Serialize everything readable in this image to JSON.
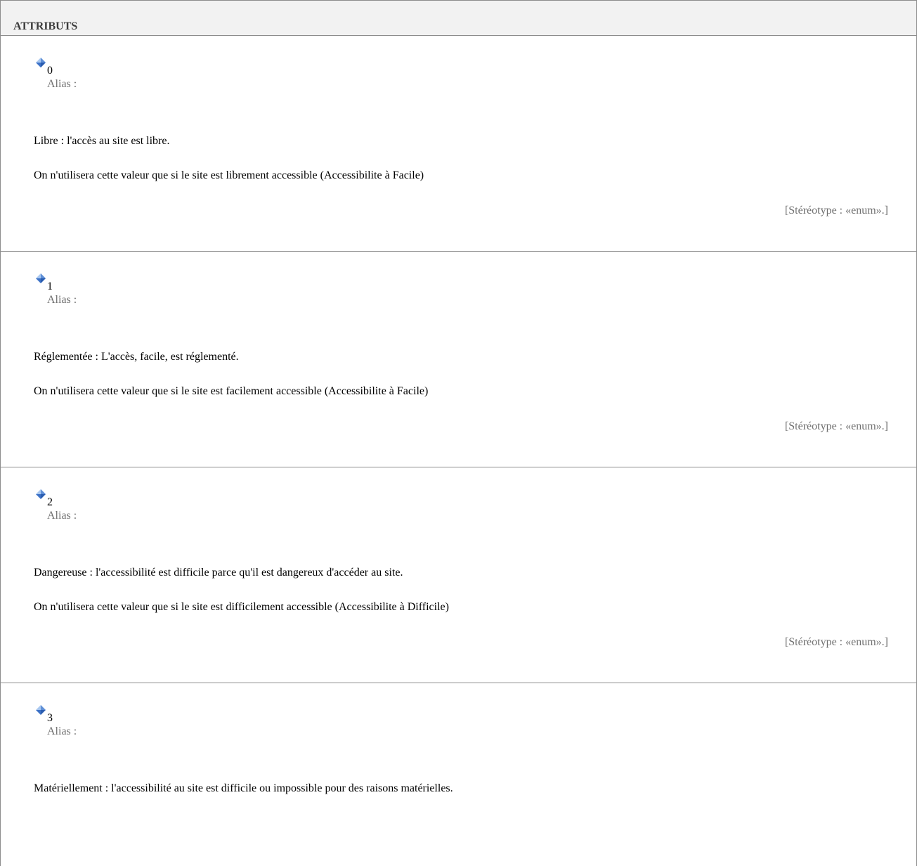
{
  "section": {
    "title": "ATTRIBUTS"
  },
  "attributes": [
    {
      "name": "0",
      "alias": "Alias :",
      "description_lines": [
        "Libre : l'accès au site est libre.",
        "On n'utilisera cette valeur que si le site est librement accessible (Accessibilite à Facile)"
      ],
      "stereotype": "[Stéréotype : «enum».]"
    },
    {
      "name": "1",
      "alias": "Alias :",
      "description_lines": [
        "Réglementée : L'accès, facile, est réglementé.",
        "On n'utilisera cette valeur que si le site est facilement accessible (Accessibilite à Facile)"
      ],
      "stereotype": "[Stéréotype : «enum».]"
    },
    {
      "name": "2",
      "alias": "Alias :",
      "description_lines": [
        "Dangereuse : l'accessibilité est difficile parce qu'il est dangereux d'accéder au site.",
        "On n'utilisera cette valeur que si le site est difficilement accessible (Accessibilite à Difficile)"
      ],
      "stereotype": "[Stéréotype : «enum».]"
    },
    {
      "name": "3",
      "alias": "Alias :",
      "description_lines": [
        "Matériellement : l'accessibilité au site est difficile ou impossible pour des raisons matérielles."
      ],
      "stereotype": ""
    }
  ],
  "icons": {
    "attribute_icon": "attribute-diamond-icon",
    "icon_color_light": "#a9c8f0",
    "icon_color_dark": "#2a5db0"
  }
}
